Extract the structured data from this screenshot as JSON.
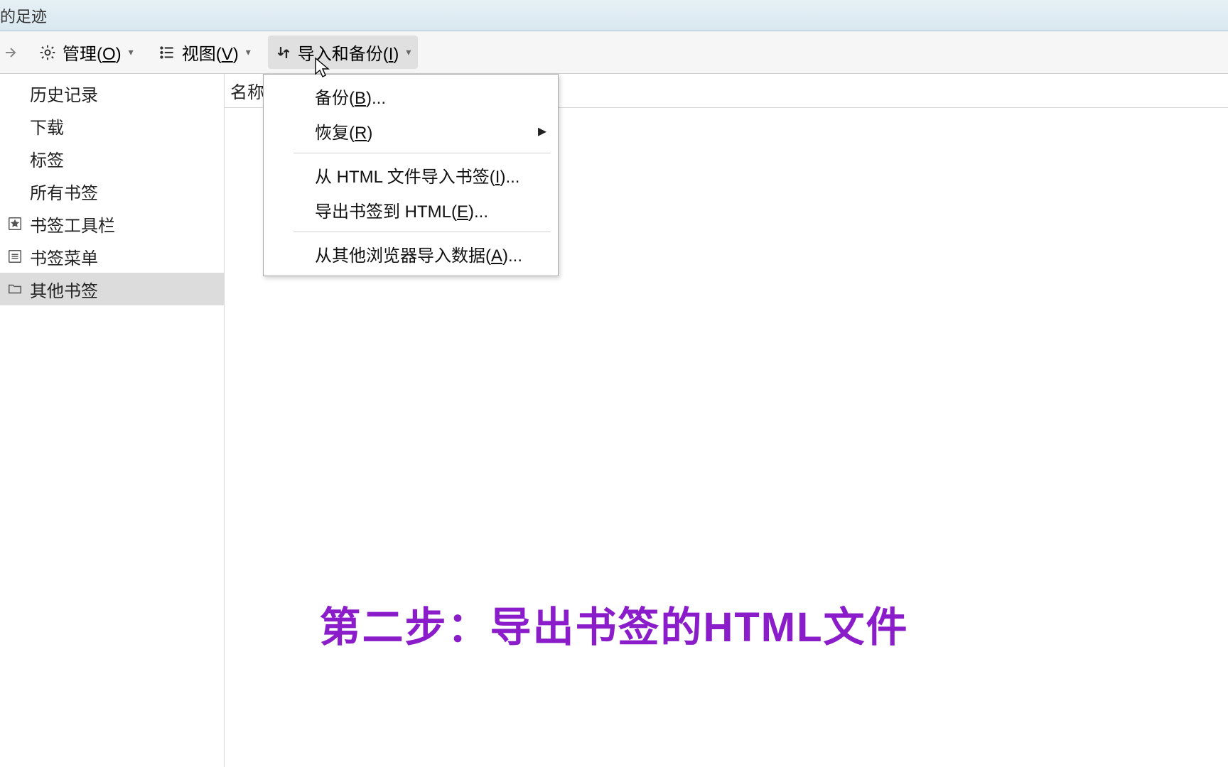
{
  "window": {
    "title_fragment": "的足迹"
  },
  "toolbar": {
    "manage_label": "管理(O)",
    "view_label": "视图(V)",
    "import_label": "导入和备份(I)",
    "underline": {
      "manage": "O",
      "view": "V",
      "import": "I"
    }
  },
  "sidebar": {
    "items": [
      {
        "label": "历史记录",
        "icon": ""
      },
      {
        "label": "下载",
        "icon": ""
      },
      {
        "label": "标签",
        "icon": ""
      },
      {
        "label": "所有书签",
        "icon": ""
      },
      {
        "label": "书签工具栏",
        "icon": "star"
      },
      {
        "label": "书签菜单",
        "icon": "list"
      },
      {
        "label": "其他书签",
        "icon": "folder",
        "selected": true
      }
    ]
  },
  "content": {
    "column_name": "名称"
  },
  "menu": {
    "items": [
      {
        "label": "备份(B)...",
        "u": "B"
      },
      {
        "label": "恢复(R)",
        "u": "R",
        "submenu": true
      },
      "sep",
      {
        "label": "从 HTML 文件导入书签(I)...",
        "u": "I"
      },
      {
        "label": "导出书签到 HTML(E)...",
        "u": "E"
      },
      "sep",
      {
        "label": "从其他浏览器导入数据(A)...",
        "u": "A"
      }
    ]
  },
  "caption": "第二步：导出书签的HTML文件"
}
